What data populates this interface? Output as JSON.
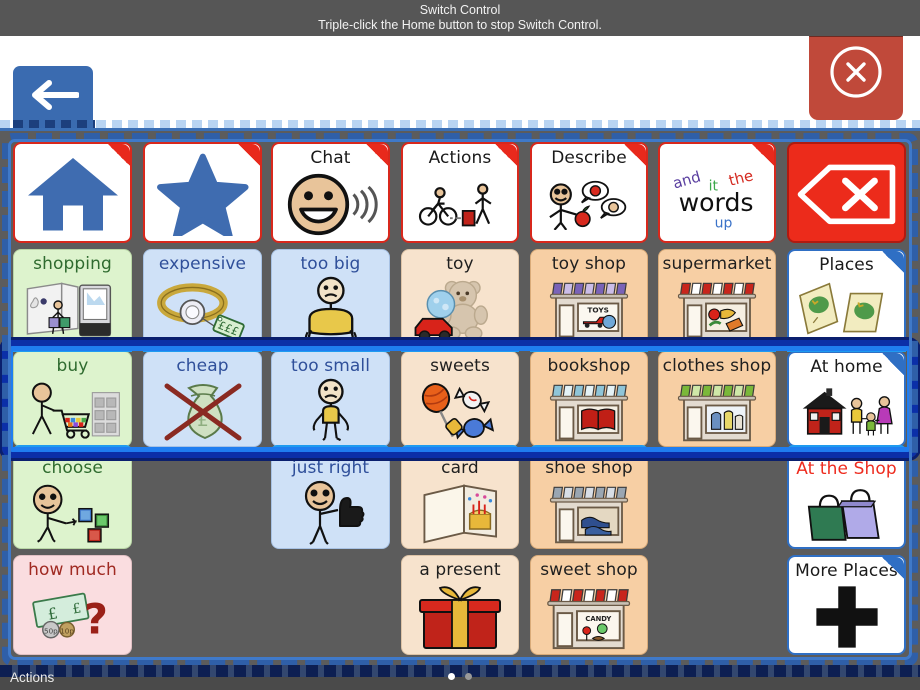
{
  "switch_control": {
    "title": "Switch Control",
    "subtitle": "Triple-click the Home button to stop Switch Control."
  },
  "appbar": {
    "back_button": "back-arrow",
    "close_button": "close-x"
  },
  "bottom_bar": {
    "label": "Actions",
    "page_dots": 2,
    "active_dot": 1
  },
  "colors": {
    "highlight_blue": "#1f7df0",
    "highlight_outline": "#0b2fa8",
    "group_dash": "#2f5fa8",
    "nav_red": "#e8291c",
    "nav_blue": "#2f6fc4",
    "cell_green": "#ddf3cd",
    "cell_blue": "#cfe1f7",
    "cell_peach": "#f7e3cd",
    "cell_orange": "#f7cfa4",
    "cell_pink": "#fadde0",
    "cell_white": "#ffffff",
    "delete_red": "#ec2b1b",
    "back_btn_blue": "#3a6bb0",
    "close_btn_red": "#c0493a"
  },
  "grid": {
    "columns": 6,
    "rows": 5,
    "highlighted_row_index": 2,
    "cells": [
      [
        {
          "label": "",
          "icon": "home-icon",
          "style": "nav-white",
          "fold": "red"
        },
        {
          "label": "",
          "icon": "star-icon",
          "style": "nav-white",
          "fold": "red"
        },
        {
          "label": "Chat",
          "icon": "talking-face-icon",
          "style": "nav-white",
          "fold": "red"
        },
        {
          "label": "Actions",
          "icon": "actions-icon",
          "style": "nav-white",
          "fold": "red"
        },
        {
          "label": "Describe",
          "icon": "describe-icon",
          "style": "nav-white",
          "fold": "red"
        },
        {
          "label": "",
          "icon": "word-cloud-icon",
          "style": "nav-white",
          "fold": "red"
        },
        {
          "label": "",
          "icon": "delete-icon",
          "style": "delete",
          "fold": "none"
        }
      ],
      [
        {
          "label": "shopping",
          "icon": "shop-window-icon",
          "style": "green",
          "fold": "none"
        },
        {
          "label": "expensive",
          "icon": "gold-ring-icon",
          "style": "blue",
          "fold": "none"
        },
        {
          "label": "too big",
          "icon": "too-big-icon",
          "style": "blue",
          "fold": "none"
        },
        {
          "label": "toy",
          "icon": "teddy-car-icon",
          "style": "peach",
          "fold": "none"
        },
        {
          "label": "toy shop",
          "icon": "toy-shop-icon",
          "style": "orange",
          "fold": "none"
        },
        {
          "label": "supermarket",
          "icon": "supermarket-icon",
          "style": "orange",
          "fold": "none"
        },
        {
          "label": "Places",
          "icon": "maps-icon",
          "style": "folder",
          "fold": "blue"
        }
      ],
      [
        {
          "label": "buy",
          "icon": "trolley-icon",
          "style": "green",
          "fold": "none"
        },
        {
          "label": "cheap",
          "icon": "crossed-bag-icon",
          "style": "blue",
          "fold": "none"
        },
        {
          "label": "too small",
          "icon": "too-small-icon",
          "style": "blue",
          "fold": "none"
        },
        {
          "label": "sweets",
          "icon": "sweets-icon",
          "style": "peach",
          "fold": "none"
        },
        {
          "label": "bookshop",
          "icon": "bookshop-icon",
          "style": "orange",
          "fold": "none"
        },
        {
          "label": "clothes shop",
          "icon": "clothes-shop-icon",
          "style": "orange",
          "fold": "none"
        },
        {
          "label": "At home",
          "icon": "house-family-icon",
          "style": "folder",
          "fold": "blue"
        }
      ],
      [
        {
          "label": "choose",
          "icon": "choose-icon",
          "style": "green",
          "fold": "none"
        },
        {
          "label": "",
          "icon": "",
          "style": "empty",
          "fold": "none"
        },
        {
          "label": "just right",
          "icon": "thumbs-up-icon",
          "style": "blue",
          "fold": "none"
        },
        {
          "label": "card",
          "icon": "card-icon",
          "style": "peach",
          "fold": "none"
        },
        {
          "label": "shoe shop",
          "icon": "shoe-shop-icon",
          "style": "orange",
          "fold": "none"
        },
        {
          "label": "",
          "icon": "",
          "style": "empty",
          "fold": "none"
        },
        {
          "label": "At the Shop",
          "icon": "shopping-bags-icon",
          "style": "folder-red",
          "fold": "none"
        }
      ],
      [
        {
          "label": "how much",
          "icon": "money-question-icon",
          "style": "pink",
          "fold": "none"
        },
        {
          "label": "",
          "icon": "",
          "style": "empty",
          "fold": "none"
        },
        {
          "label": "",
          "icon": "",
          "style": "empty",
          "fold": "none"
        },
        {
          "label": "a present",
          "icon": "present-icon",
          "style": "peach",
          "fold": "none"
        },
        {
          "label": "sweet shop",
          "icon": "sweet-shop-icon",
          "style": "orange",
          "fold": "none"
        },
        {
          "label": "",
          "icon": "",
          "style": "empty",
          "fold": "none"
        },
        {
          "label": "More Places",
          "icon": "plus-icon",
          "style": "folder",
          "fold": "blue"
        }
      ]
    ]
  },
  "word_cloud": {
    "and": "and",
    "it": "it",
    "the": "the",
    "words": "words",
    "up": "up",
    "and_color": "#5a3fa0",
    "it_color": "#3aa84a",
    "the_color": "#d42a20",
    "words_color": "#101010",
    "up_color": "#3a72c8"
  }
}
